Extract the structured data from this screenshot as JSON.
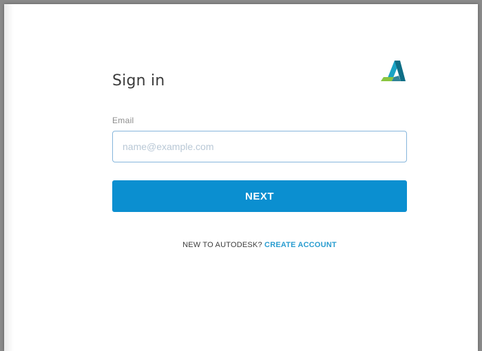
{
  "signin": {
    "title": "Sign in",
    "logo_alt": "Autodesk logo",
    "email_label": "Email",
    "email_placeholder": "name@example.com",
    "email_value": "",
    "next_label": "NEXT",
    "signup_prompt": "NEW TO AUTODESK?",
    "create_account_label": "CREATE ACCOUNT"
  },
  "colors": {
    "primary_button": "#0b8fd0",
    "link": "#2a9dd0",
    "input_border": "#86b6dc",
    "logo_dark": "#0d6e86",
    "logo_mid": "#1aa3c4",
    "logo_green": "#89c540"
  }
}
